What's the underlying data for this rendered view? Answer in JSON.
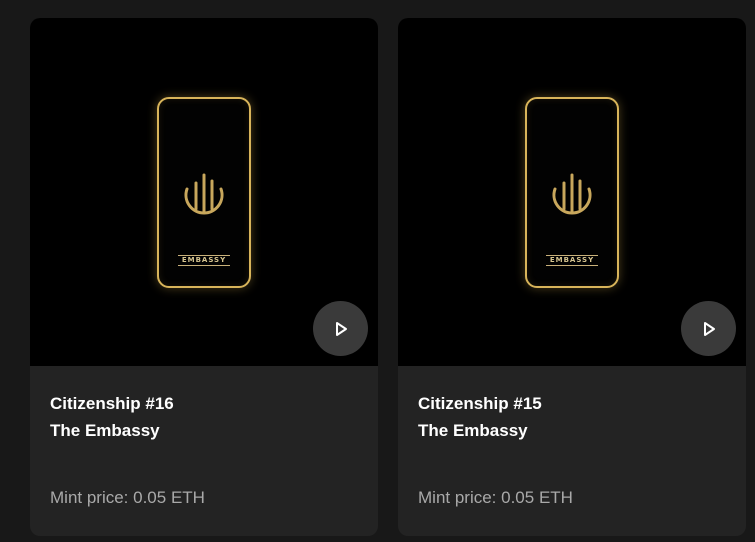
{
  "cards": [
    {
      "name": "Citizenship #16",
      "collection": "The Embassy",
      "price": "Mint price: 0.05 ETH",
      "wordmark": "EMBASSY",
      "icon": "play-icon"
    },
    {
      "name": "Citizenship #15",
      "collection": "The Embassy",
      "price": "Mint price: 0.05 ETH",
      "wordmark": "EMBASSY",
      "icon": "play-icon"
    }
  ],
  "colors": {
    "background": "#181818",
    "card": "#232323",
    "gold": "#d8b45a",
    "price_text": "#a9a9a9"
  }
}
